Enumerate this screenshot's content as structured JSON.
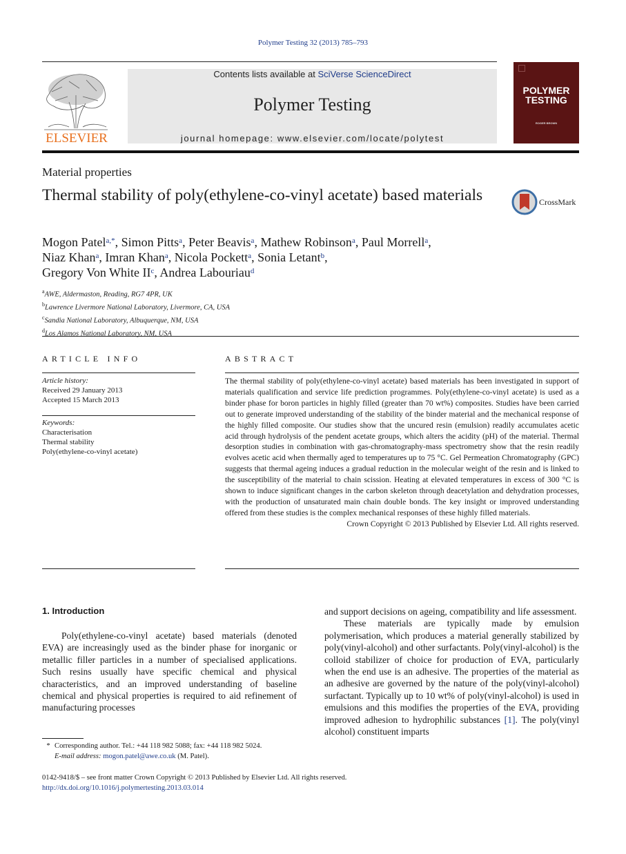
{
  "header": {
    "journal_ref": "Polymer Testing 32 (2013) 785–793",
    "contents_prefix": "Contents lists available at ",
    "contents_link": "SciVerse ScienceDirect",
    "journal_title": "Polymer Testing",
    "homepage": "journal homepage: www.elsevier.com/locate/polytest",
    "publisher_logo_text": "ELSEVIER",
    "cover": {
      "title_line1": "POLYMER",
      "title_line2": "TESTING",
      "editor": "ROGER BROWN"
    }
  },
  "colors": {
    "link": "#1f3c8a",
    "elsevier_orange": "#e8701e",
    "cover_bg": "#5a1414",
    "masthead_bg": "#e8e8e8"
  },
  "article": {
    "section": "Material properties",
    "title": "Thermal stability of poly(ethylene-co-vinyl acetate) based materials",
    "crossmark_label": "CrossMark",
    "authors": [
      {
        "name": "Mogon Patel",
        "sup": "a,*",
        "sep": ", "
      },
      {
        "name": "Simon Pitts",
        "sup": "a",
        "sep": ", "
      },
      {
        "name": "Peter Beavis",
        "sup": "a",
        "sep": ", "
      },
      {
        "name": "Mathew Robinson",
        "sup": "a",
        "sep": ", "
      },
      {
        "name": "Paul Morrell",
        "sup": "a",
        "sep": ","
      },
      {
        "name": "Niaz Khan",
        "sup": "a",
        "sep": ", "
      },
      {
        "name": "Imran Khan",
        "sup": "a",
        "sep": ", "
      },
      {
        "name": "Nicola Pockett",
        "sup": "a",
        "sep": ", "
      },
      {
        "name": "Sonia Letant",
        "sup": "b",
        "sep": ","
      },
      {
        "name": "Gregory Von White II",
        "sup": "c",
        "sep": ", "
      },
      {
        "name": "Andrea Labouriau",
        "sup": "d",
        "sep": ""
      }
    ],
    "affiliations": [
      {
        "sup": "a",
        "text": "AWE, Aldermaston, Reading, RG7 4PR, UK"
      },
      {
        "sup": "b",
        "text": "Lawrence Livermore National Laboratory, Livermore, CA, USA"
      },
      {
        "sup": "c",
        "text": "Sandia National Laboratory, Albuquerque, NM, USA"
      },
      {
        "sup": "d",
        "text": "Los Alamos National Laboratory, NM, USA"
      }
    ]
  },
  "article_info": {
    "heading": "ARTICLE INFO",
    "history_label": "Article history:",
    "received": "Received 29 January 2013",
    "accepted": "Accepted 15 March 2013",
    "keywords_label": "Keywords:",
    "keywords": [
      "Characterisation",
      "Thermal stability",
      "Poly(ethylene-co-vinyl acetate)"
    ]
  },
  "abstract": {
    "heading": "ABSTRACT",
    "body": "The thermal stability of poly(ethylene-co-vinyl acetate) based materials has been investigated in support of materials qualification and service life prediction programmes. Poly(ethylene-co-vinyl acetate) is used as a binder phase for boron particles in highly filled (greater than 70 wt%) composites. Studies have been carried out to generate improved understanding of the stability of the binder material and the mechanical response of the highly filled composite. Our studies show that the uncured resin (emulsion) readily accumulates acetic acid through hydrolysis of the pendent acetate groups, which alters the acidity (pH) of the material. Thermal desorption studies in combination with gas-chromatography-mass spectrometry show that the resin readily evolves acetic acid when thermally aged to temperatures up to 75 °C. Gel Permeation Chromatography (GPC) suggests that thermal ageing induces a gradual reduction in the molecular weight of the resin and is linked to the susceptibility of the material to chain scission. Heating at elevated temperatures in excess of 300 °C is shown to induce significant changes in the carbon skeleton through deacetylation and dehydration processes, with the production of unsaturated main chain double bonds. The key insight or improved understanding offered from these studies is the complex mechanical responses of these highly filled materials.",
    "copyright": "Crown Copyright © 2013 Published by Elsevier Ltd. All rights reserved."
  },
  "introduction": {
    "heading": "1.  Introduction",
    "left_para": "Poly(ethylene-co-vinyl acetate) based materials (denoted EVA) are increasingly used as the binder phase for inorganic or metallic filler particles in a number of specialised applications. Such resins usually have specific chemical and physical characteristics, and an improved understanding of baseline chemical and physical properties is required to aid refinement of manufacturing processes",
    "right_cont": "and support decisions on ageing, compatibility and life assessment.",
    "right_para_before_ref": "These materials are typically made by emulsion polymerisation, which produces a material generally stabilized by poly(vinyl-alcohol) and other surfactants. Poly(vinyl-alcohol) is the colloid stabilizer of choice for production of EVA, particularly when the end use is an adhesive. The properties of the material as an adhesive are governed by the nature of the poly(vinyl-alcohol) surfactant. Typically up to 10 wt% of poly(vinyl-alcohol) is used in emulsions and this modifies the properties of the EVA, providing improved adhesion to hydrophilic substances ",
    "ref": "[1]",
    "right_para_after_ref": ". The poly(vinyl alcohol) constituent imparts"
  },
  "footnote": {
    "star": "*",
    "corresponding": "Corresponding author. Tel.: +44 118 982 5088; fax: +44 118 982 5024.",
    "email_label": "E-mail address:",
    "email": "mogon.patel@awe.co.uk",
    "email_suffix": " (M. Patel)."
  },
  "front_matter": {
    "issn_line": "0142-9418/$ – see front matter Crown Copyright © 2013 Published by Elsevier Ltd. All rights reserved.",
    "doi": "http://dx.doi.org/10.1016/j.polymertesting.2013.03.014"
  }
}
